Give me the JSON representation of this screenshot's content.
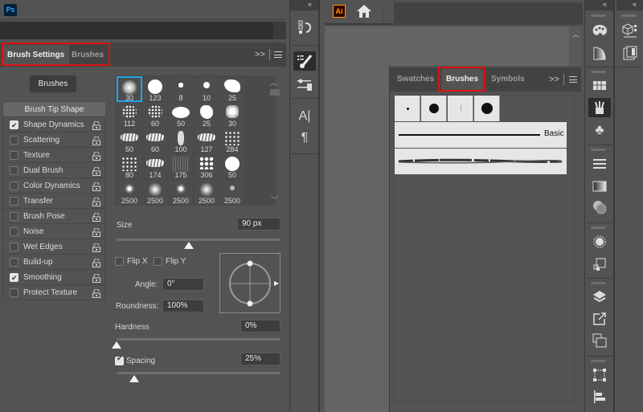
{
  "photoshop": {
    "app_logo": "Ps",
    "tabs": [
      {
        "label": "Brush Settings",
        "active": true
      },
      {
        "label": "Brushes",
        "active": false
      }
    ],
    "expand_glyph": ">>",
    "brushes_button": "Brushes",
    "options": [
      {
        "label": "Brush Tip Shape",
        "checkbox": false,
        "checked": false,
        "lock": false,
        "selected": true
      },
      {
        "label": "Shape Dynamics",
        "checkbox": true,
        "checked": true,
        "lock": true
      },
      {
        "label": "Scattering",
        "checkbox": true,
        "checked": false,
        "lock": true
      },
      {
        "label": "Texture",
        "checkbox": true,
        "checked": false,
        "lock": true
      },
      {
        "label": "Dual Brush",
        "checkbox": true,
        "checked": false,
        "lock": true
      },
      {
        "label": "Color Dynamics",
        "checkbox": true,
        "checked": false,
        "lock": true
      },
      {
        "label": "Transfer",
        "checkbox": true,
        "checked": false,
        "lock": true
      },
      {
        "label": "Brush Pose",
        "checkbox": true,
        "checked": false,
        "lock": true
      },
      {
        "label": "Noise",
        "checkbox": true,
        "checked": false,
        "lock": true
      },
      {
        "label": "Wet Edges",
        "checkbox": true,
        "checked": false,
        "lock": true
      },
      {
        "label": "Build-up",
        "checkbox": true,
        "checked": false,
        "lock": true
      },
      {
        "label": "Smoothing",
        "checkbox": true,
        "checked": true,
        "lock": true
      },
      {
        "label": "Protect Texture",
        "checkbox": true,
        "checked": false,
        "lock": true
      }
    ],
    "brush_tips": [
      {
        "size": "30",
        "kind": "soft",
        "selected": true
      },
      {
        "size": "123",
        "kind": "hard"
      },
      {
        "size": "8",
        "kind": "splat"
      },
      {
        "size": "10",
        "kind": "small-hard"
      },
      {
        "size": "25",
        "kind": "rough"
      },
      {
        "size": "112",
        "kind": "speckle"
      },
      {
        "size": "60",
        "kind": "speckle"
      },
      {
        "size": "50",
        "kind": "oval"
      },
      {
        "size": "25",
        "kind": "blob"
      },
      {
        "size": "30",
        "kind": "soft-square"
      },
      {
        "size": "50",
        "kind": "stroke"
      },
      {
        "size": "60",
        "kind": "stroke"
      },
      {
        "size": "100",
        "kind": "tall"
      },
      {
        "size": "127",
        "kind": "stroke"
      },
      {
        "size": "284",
        "kind": "spray"
      },
      {
        "size": "80",
        "kind": "spray"
      },
      {
        "size": "174",
        "kind": "stroke"
      },
      {
        "size": "175",
        "kind": "faint"
      },
      {
        "size": "306",
        "kind": "flakes"
      },
      {
        "size": "50",
        "kind": "hard"
      },
      {
        "size": "2500",
        "kind": "star"
      },
      {
        "size": "2500",
        "kind": "glow"
      },
      {
        "size": "2500",
        "kind": "star"
      },
      {
        "size": "2500",
        "kind": "glow"
      },
      {
        "size": "2500",
        "kind": "dot"
      }
    ],
    "size": {
      "label": "Size",
      "value": "90 px",
      "fraction": 0.44
    },
    "flip_x": {
      "label": "Flip X",
      "checked": false
    },
    "flip_y": {
      "label": "Flip Y",
      "checked": false
    },
    "angle": {
      "label": "Angle:",
      "value": "0°"
    },
    "roundness": {
      "label": "Roundness:",
      "value": "100%"
    },
    "hardness": {
      "label": "Hardness",
      "value": "0%",
      "fraction": 0.0
    },
    "spacing": {
      "label": "Spacing",
      "value": "25%",
      "checked": true,
      "fraction": 0.11
    }
  },
  "illustrator": {
    "app_logo": "Ai",
    "tabs": [
      {
        "label": "Swatches",
        "active": false
      },
      {
        "label": "Brushes",
        "active": true
      },
      {
        "label": "Symbols",
        "active": false
      }
    ],
    "expand_glyph": ">>",
    "brush_library": {
      "calligraphic": [
        "small-dot",
        "round",
        "thin-line",
        "large-round"
      ],
      "strokes": [
        {
          "name": "Basic",
          "kind": "basic"
        },
        {
          "name": "",
          "kind": "charcoal"
        }
      ]
    }
  },
  "colors": {
    "highlight_red": "#e01010",
    "selection_blue": "#1ea7e4",
    "ps_logo_blue": "#31a8ff",
    "ai_logo_orange": "#ff9a00"
  }
}
